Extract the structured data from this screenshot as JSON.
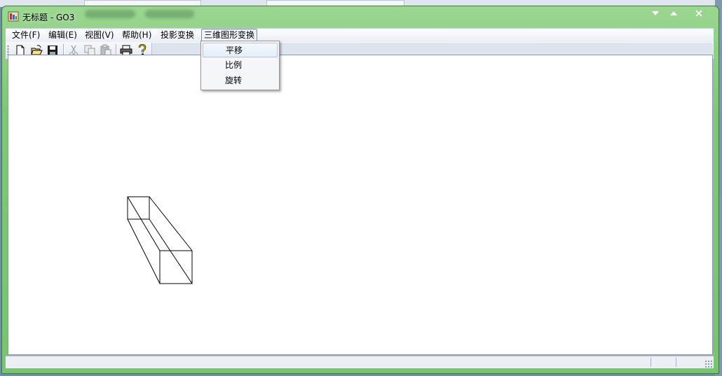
{
  "window": {
    "title": "无标题 - GO3",
    "controls": [
      "minimize-icon",
      "maximize-icon",
      "close-icon"
    ]
  },
  "menubar": {
    "items": [
      {
        "label": "文件(F)"
      },
      {
        "label": "编辑(E)"
      },
      {
        "label": "视图(V)"
      },
      {
        "label": "帮助(H)"
      },
      {
        "label": "投影变换"
      },
      {
        "label": "三维图形变换"
      }
    ]
  },
  "toolbar": {
    "buttons": [
      "new-document-icon",
      "open-folder-icon",
      "save-icon",
      "cut-icon",
      "copy-icon",
      "paste-icon",
      "print-icon",
      "help-icon"
    ]
  },
  "dropdown": {
    "items": [
      {
        "label": "平移"
      },
      {
        "label": "比例"
      },
      {
        "label": "旋转"
      }
    ]
  },
  "colors": {
    "titlebar": "#7cc874",
    "canvas": "#ffffff",
    "menu_highlight": "#e4eefa"
  }
}
